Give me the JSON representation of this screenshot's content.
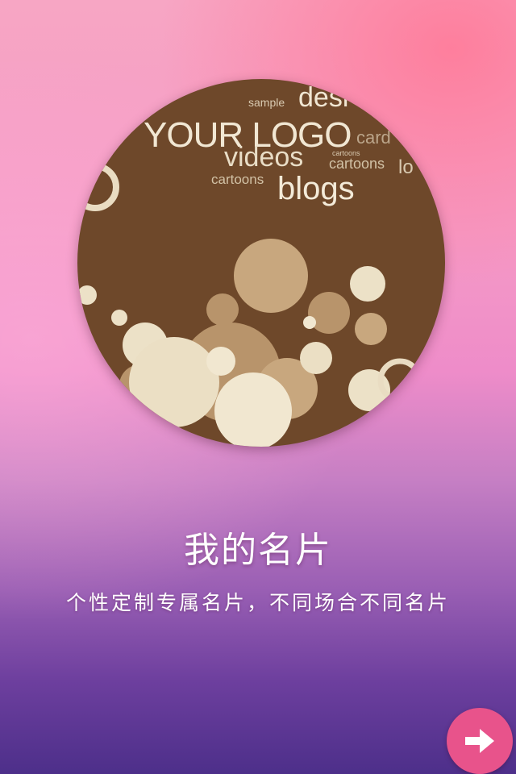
{
  "hero": {
    "words": {
      "logo": "YOUR LOGO",
      "videos": "videos",
      "blogs": "blogs",
      "sample": "sample",
      "design": "desi",
      "card": "card",
      "cartoons_small": "cartoons",
      "cartoons_1": "cartoons",
      "cartoons_2": "cartoons",
      "log": "lo"
    }
  },
  "content": {
    "title": "我的名片",
    "subtitle": "个性定制专属名片，不同场合不同名片"
  },
  "next_button": {
    "icon": "arrow-right-icon"
  },
  "colors": {
    "accent": "#e8538b",
    "circle_background": "#6e482a"
  }
}
